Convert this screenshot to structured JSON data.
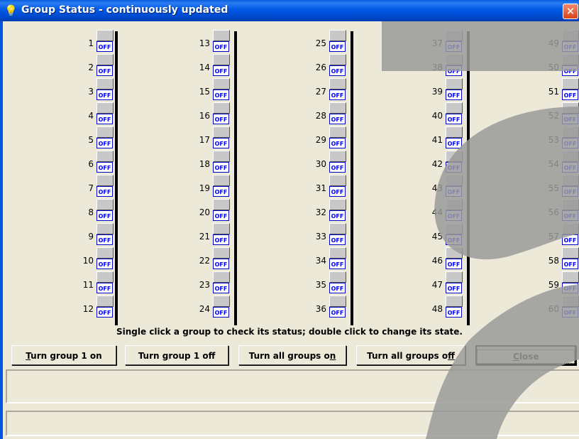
{
  "window": {
    "title": "Group Status - continuously updated",
    "title_icon": "lightbulb-icon",
    "close_glyph": "✕"
  },
  "groups": {
    "state_label": "OFF",
    "columns": [
      [
        1,
        2,
        3,
        4,
        5,
        6,
        7,
        8,
        9,
        10,
        11,
        12
      ],
      [
        13,
        14,
        15,
        16,
        17,
        18,
        19,
        20,
        21,
        22,
        23,
        24
      ],
      [
        25,
        26,
        27,
        28,
        29,
        30,
        31,
        32,
        33,
        34,
        35,
        36
      ],
      [
        37,
        38,
        39,
        40,
        41,
        42,
        43,
        44,
        45,
        46,
        47,
        48
      ],
      [
        49,
        50,
        51,
        52,
        53,
        54,
        55,
        56,
        57,
        58,
        59,
        60
      ]
    ]
  },
  "instructions": "Single click a group to check its status; double click to change its state.",
  "buttons": {
    "turn_group_on": {
      "pre": "",
      "u": "T",
      "post": "urn group 1 on"
    },
    "turn_group_off": {
      "pre": "Turn ",
      "u": "g",
      "post": "roup 1 off"
    },
    "turn_all_on": {
      "pre": "Turn all groups o",
      "u": "n",
      "post": ""
    },
    "turn_all_off": {
      "pre": "Turn all groups o",
      "u": "f",
      "post": "f"
    },
    "close": {
      "pre": "",
      "u": "C",
      "post": "lose"
    }
  },
  "colors": {
    "title_bar": "#0054e3",
    "off_text": "#0000ff",
    "background": "#ece9d8"
  }
}
